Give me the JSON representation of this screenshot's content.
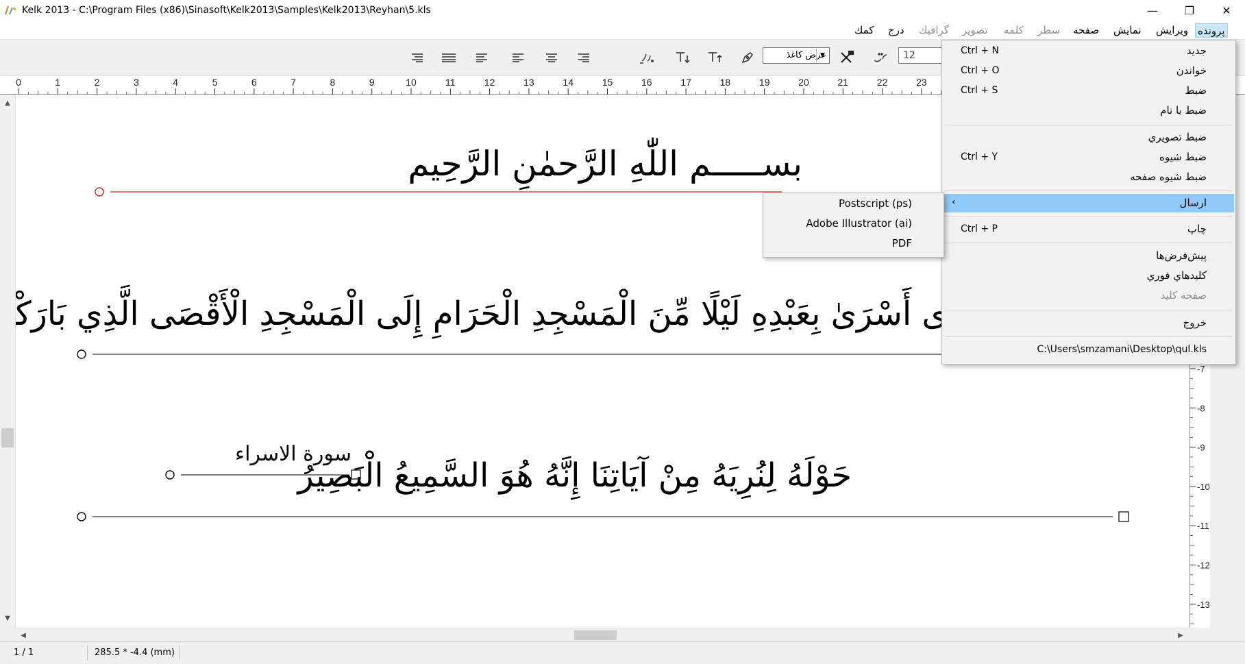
{
  "window": {
    "title": "Kelk 2013 - C:\\Program Files (x86)\\Sinasoft\\Kelk2013\\Samples\\Kelk2013\\Reyhan\\5.kls",
    "minimize": "—",
    "maximize": "❐",
    "close": "✕"
  },
  "menubar": {
    "items": [
      {
        "label": "پرونده",
        "state": "active"
      },
      {
        "label": "ويرايش",
        "state": "enabled"
      },
      {
        "label": "نمايش",
        "state": "enabled"
      },
      {
        "label": "صفحه",
        "state": "enabled"
      },
      {
        "label": "سطر",
        "state": "disabled"
      },
      {
        "label": "كلمه",
        "state": "disabled"
      },
      {
        "label": "تصوير",
        "state": "disabled"
      },
      {
        "label": "گرافيك",
        "state": "disabled"
      },
      {
        "label": "درج",
        "state": "enabled"
      },
      {
        "label": "كمك",
        "state": "enabled"
      }
    ]
  },
  "toolbar": {
    "paper_select": "عرض كاغذ",
    "font_size": "12"
  },
  "ruler": {
    "numbers": [
      "0",
      "1",
      "2",
      "3",
      "4",
      "5",
      "6",
      "7",
      "8",
      "9",
      "10",
      "11",
      "12",
      "13",
      "14",
      "15",
      "16",
      "17",
      "18",
      "19",
      "20",
      "21",
      "22",
      "23"
    ]
  },
  "vruler": {
    "numbers": [
      "-7",
      "-8",
      "-9",
      "-10",
      "-11",
      "-12",
      "-13"
    ]
  },
  "canvas": {
    "line1": "بســـــم اللّٰهِ الرَّحمٰنِ الرَّحِيم",
    "line2": "ى أَسْرَىٰ بِعَبْدِهِ لَيْلًا مِّنَ الْمَسْجِدِ الْحَرَامِ إِلَى الْمَسْجِدِ الْأَقْصَى الَّذِي بَارَكْنَا",
    "line3_title": "سورة الاسراء",
    "line4": "حَوْلَهُ لِنُرِيَهُ مِنْ آيَاتِنَا إِنَّهُ هُوَ السَّمِيعُ الْبَصِيرُ"
  },
  "file_menu": {
    "items": [
      {
        "label": "جديد",
        "shortcut": "Ctrl + N"
      },
      {
        "label": "خواندن",
        "shortcut": "Ctrl + O"
      },
      {
        "label": "ضبط",
        "shortcut": "Ctrl + S"
      },
      {
        "label": "ضبط با نام",
        "shortcut": ""
      },
      {
        "label": "ضبط تصويري",
        "shortcut": ""
      },
      {
        "label": "ضبط شيوه",
        "shortcut": "Ctrl + Y"
      },
      {
        "label": "ضبط شيوه صفحه",
        "shortcut": ""
      },
      {
        "label": "ارسال",
        "shortcut": "",
        "submenu_arrow": "‹"
      },
      {
        "label": "چاپ",
        "shortcut": "Ctrl + P"
      },
      {
        "label": "پيش‌فرض‌ها",
        "shortcut": ""
      },
      {
        "label": "كليدهاي فوري",
        "shortcut": ""
      },
      {
        "label": "صفحه كليد",
        "shortcut": "",
        "disabled": true
      },
      {
        "label": "خروج",
        "shortcut": ""
      }
    ],
    "recent_file": "C:\\Users\\smzamani\\Desktop\\qul.kls"
  },
  "send_submenu": {
    "items": [
      "Postscript (ps)",
      "Adobe Illustrator (ai)",
      "PDF"
    ]
  },
  "status": {
    "page": "1 / 1",
    "coords": "285.5 * -4.4 (mm)"
  },
  "colors": {
    "menu_highlight": "#91c9f7",
    "menubar_active": "#cce8ff",
    "guide_red": "#e02020"
  }
}
